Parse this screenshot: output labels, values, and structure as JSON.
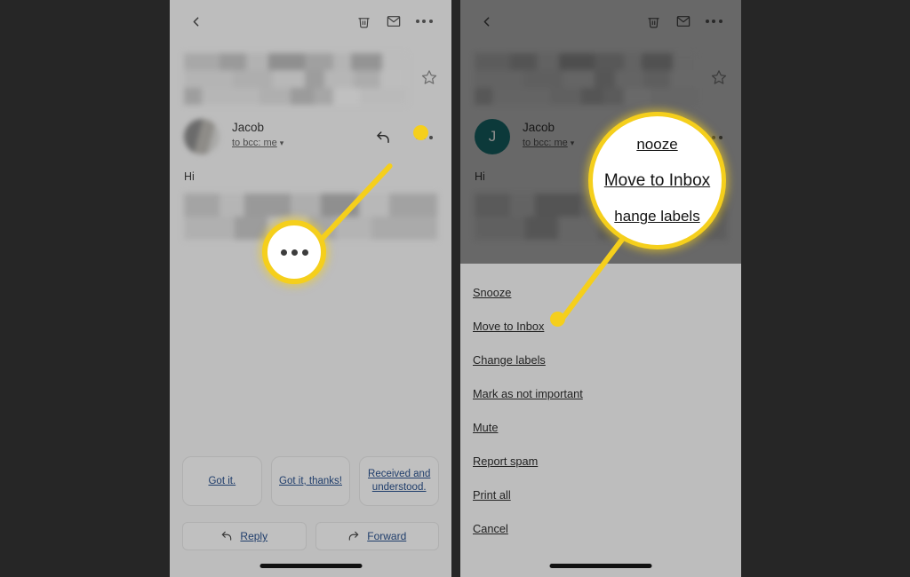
{
  "canvas": {
    "background": "#262626",
    "accent": "#f5cf1c"
  },
  "left_phone": {
    "appbar": {
      "back_icon": "chevron-left-icon",
      "delete_icon": "trash-icon",
      "mark_unread_icon": "envelope-icon",
      "overflow_icon": "more-horizontal-icon"
    },
    "subject": {
      "redacted": true,
      "star_icon": "star-outline-icon"
    },
    "message": {
      "avatar": {
        "type": "blurred-photo",
        "initial": ""
      },
      "sender": "Jacob",
      "recipients": "to bcc: me",
      "recipients_caret": "⌄",
      "reply_icon": "reply-arrow-icon",
      "overflow_icon": "more-horizontal-icon",
      "greeting": "Hi",
      "body_redacted": true
    },
    "smart_replies": [
      "Got it.",
      "Got it, thanks!",
      "Received and understood."
    ],
    "actions": [
      {
        "label": "Reply",
        "icon": "reply-arrow-icon"
      },
      {
        "label": "Forward",
        "icon": "forward-arrow-icon"
      }
    ],
    "magnifier": {
      "target": "more-horizontal-icon",
      "dots": 3
    }
  },
  "right_phone": {
    "appbar": {
      "back_icon": "chevron-left-icon",
      "delete_icon": "trash-icon",
      "mark_unread_icon": "envelope-icon",
      "overflow_icon": "more-horizontal-icon"
    },
    "subject": {
      "redacted": true,
      "star_icon": "star-outline-icon"
    },
    "message": {
      "avatar": {
        "type": "initial",
        "initial": "J",
        "color": "#17696b"
      },
      "sender": "Jacob",
      "recipients": "to bcc: me",
      "recipients_caret": "⌄",
      "overflow_icon": "more-horizontal-icon",
      "greeting": "Hi",
      "body_redacted": true
    },
    "sheet_menu": [
      "Snooze",
      "Move to Inbox",
      "Change labels",
      "Mark as not important",
      "Mute",
      "Report spam",
      "Print all",
      "Cancel"
    ],
    "magnifier": {
      "above": "nooze",
      "focus": "Move to Inbox",
      "below": "hange labels"
    }
  }
}
